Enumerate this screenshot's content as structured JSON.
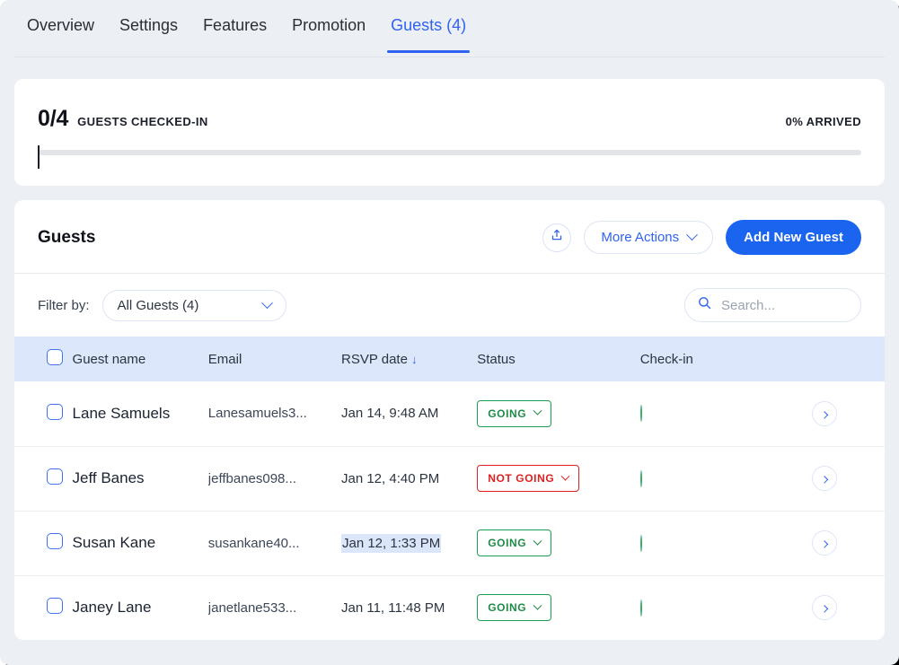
{
  "tabs": [
    {
      "label": "Overview",
      "active": false
    },
    {
      "label": "Settings",
      "active": false
    },
    {
      "label": "Features",
      "active": false
    },
    {
      "label": "Promotion",
      "active": false
    },
    {
      "label": "Guests (4)",
      "active": true
    }
  ],
  "progress": {
    "count": "0/4",
    "label": "GUESTS CHECKED-IN",
    "percent_label": "0% ARRIVED",
    "percent_value": 0
  },
  "guests_panel": {
    "title": "Guests",
    "upload_icon": "upload-icon",
    "more_actions_label": "More Actions",
    "add_guest_label": "Add New Guest",
    "filter_label": "Filter by:",
    "filter_value": "All Guests (4)",
    "search_placeholder": "Search...",
    "search_value": "",
    "search_icon": "search-icon"
  },
  "table": {
    "columns": [
      "Guest name",
      "Email",
      "RSVP date",
      "Status",
      "Check-in"
    ],
    "sorted_column": "RSVP date",
    "sort_direction": "desc",
    "sort_glyph": "↓",
    "rows": [
      {
        "checked": false,
        "name": "Lane Samuels",
        "email": "Lanesamuels3...",
        "rsvp_date": "Jan 14, 9:48 AM",
        "date_selected": false,
        "status": "GOING",
        "status_kind": "going",
        "checked_in": false
      },
      {
        "checked": false,
        "name": "Jeff Banes",
        "email": "jeffbanes098...",
        "rsvp_date": "Jan 12, 4:40 PM",
        "date_selected": false,
        "status": "NOT GOING",
        "status_kind": "notgoing",
        "checked_in": false
      },
      {
        "checked": false,
        "name": "Susan Kane",
        "email": "susankane40...",
        "rsvp_date": "Jan 12, 1:33 PM",
        "date_selected": true,
        "status": "GOING",
        "status_kind": "going",
        "checked_in": false
      },
      {
        "checked": false,
        "name": "Janey Lane",
        "email": "janetlane533...",
        "rsvp_date": "Jan 11, 11:48 PM",
        "date_selected": false,
        "status": "GOING",
        "status_kind": "going",
        "checked_in": false
      }
    ]
  },
  "colors": {
    "accent": "#2f62f0",
    "primary_button": "#1a64f0",
    "going": "#1f8a47",
    "not_going": "#e02020",
    "checkin_circle": "#35ad6b",
    "page_bg": "#eceff3",
    "table_header_bg": "#dce7fb",
    "selection_bg": "#dbe6fa"
  }
}
